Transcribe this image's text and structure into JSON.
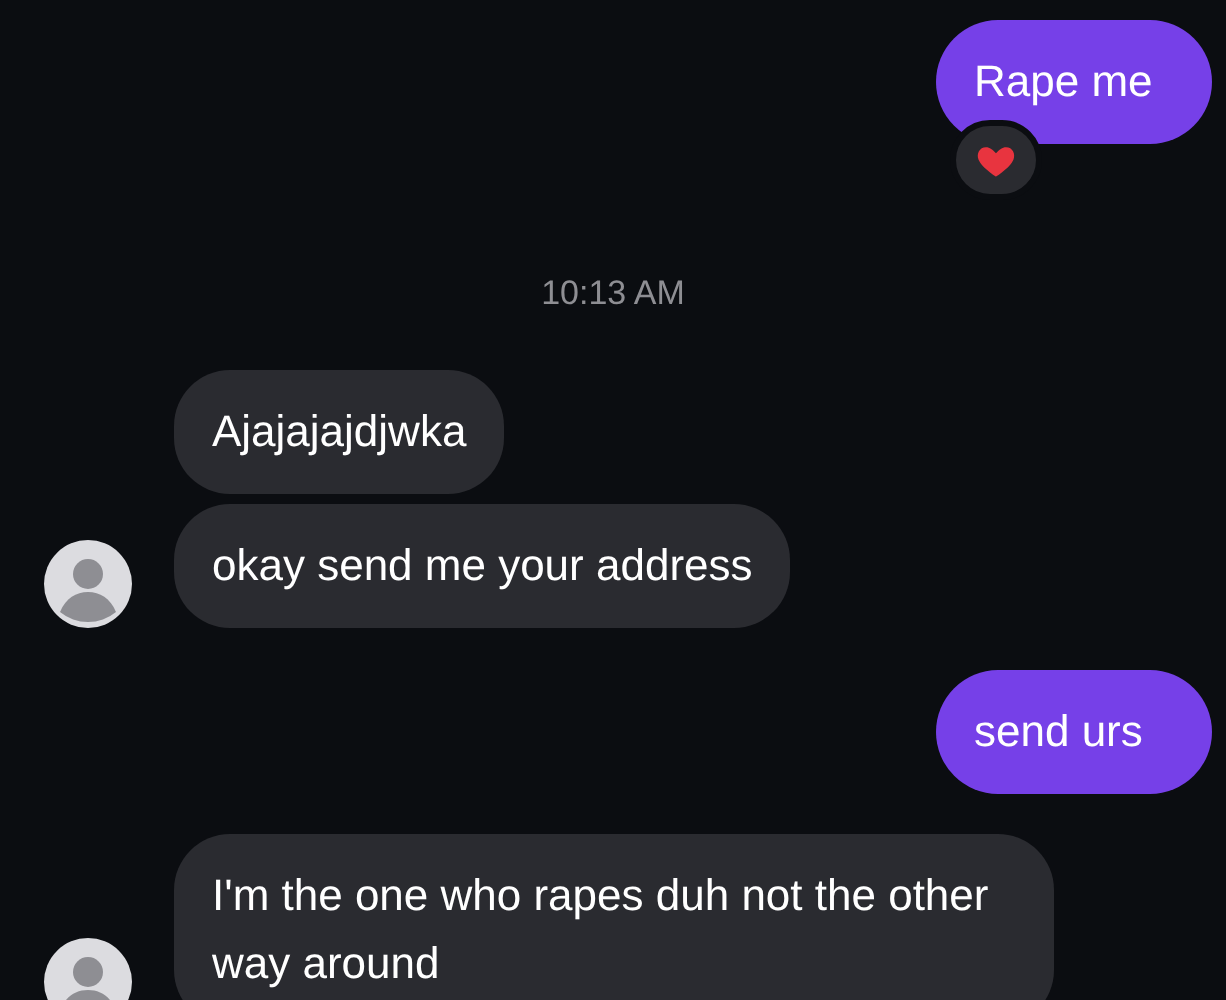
{
  "messages": [
    {
      "kind": "outgoing",
      "text": "Rape me",
      "reaction": true
    },
    {
      "kind": "timestamp",
      "text": "10:13 AM"
    },
    {
      "kind": "incoming",
      "bubbles": [
        "Ajajajajdjwka",
        "okay send me your address"
      ]
    },
    {
      "kind": "outgoing",
      "text": "send urs",
      "reaction": false
    },
    {
      "kind": "incoming",
      "bubbles": [
        "I'm the one who rapes duh not the other way around"
      ]
    }
  ]
}
